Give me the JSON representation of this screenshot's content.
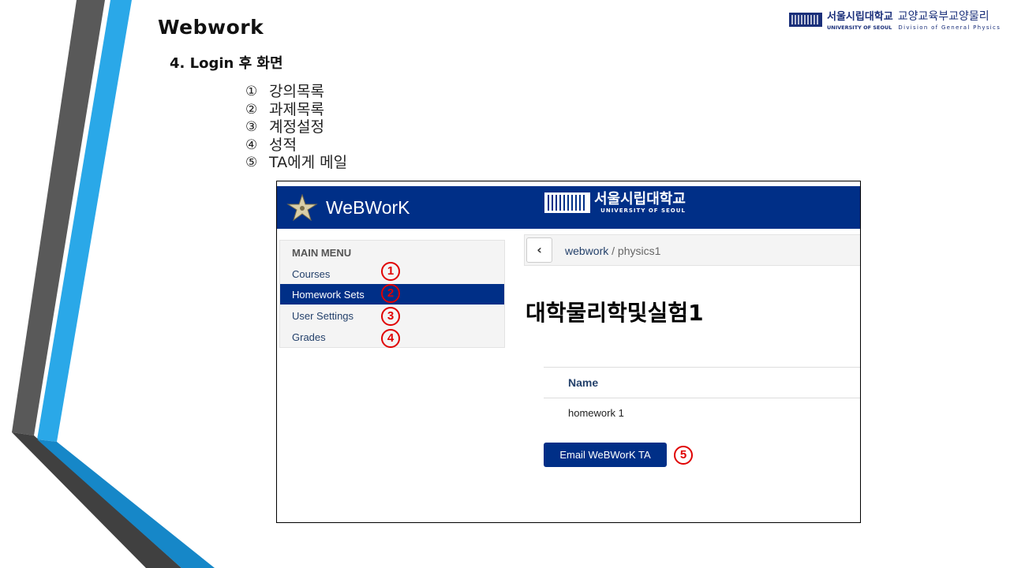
{
  "slide": {
    "title": "Webwork",
    "section": "4. Login 후 화면",
    "items": [
      {
        "num": "①",
        "label": "강의목록"
      },
      {
        "num": "②",
        "label": "과제목록"
      },
      {
        "num": "③",
        "label": "계정설정"
      },
      {
        "num": "④",
        "label": "성적"
      },
      {
        "num": "⑤",
        "label": "TA에게 메일"
      }
    ]
  },
  "org_logo": {
    "university_kr": "서울시립대학교",
    "university_en": "UNIVERSITY OF SEOUL",
    "division_kr": "교양교육부교양물리",
    "division_en": "Division of General Physics"
  },
  "webwork": {
    "logo": "WeBWorK",
    "univ_kr": "서울시립대학교",
    "univ_en": "UNIVERSITY OF SEOUL",
    "menu": {
      "heading": "MAIN MENU",
      "items": [
        {
          "label": "Courses",
          "marker": "1",
          "active": false
        },
        {
          "label": "Homework Sets",
          "marker": "2",
          "active": true
        },
        {
          "label": "User Settings",
          "marker": "3",
          "active": false
        },
        {
          "label": "Grades",
          "marker": "4",
          "active": false
        }
      ]
    },
    "breadcrumb": {
      "link": "webwork",
      "separator": " / ",
      "current": "physics1"
    },
    "course_title": "대학물리학및실험1",
    "table": {
      "header": "Name",
      "rows": [
        "homework 1"
      ]
    },
    "email_button": "Email WeBWorK TA",
    "email_marker": "5"
  },
  "colors": {
    "navy": "#002f87",
    "marker_red": "#e00000",
    "deco_gray": "#555555",
    "deco_blue": "#2aa8e8"
  },
  "icons": {
    "back": "chevron-left-icon",
    "webwork_logo": "star-icon"
  }
}
